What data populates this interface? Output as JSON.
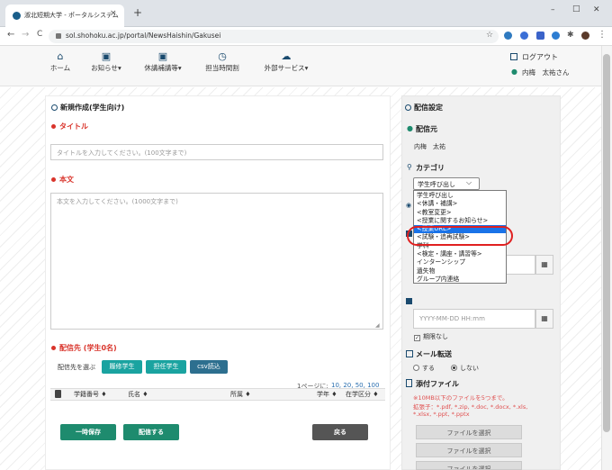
{
  "browser": {
    "tab_title": "淑北短期大学 - ポータルシステム",
    "tab_close": "×",
    "new_tab": "+",
    "url": "sol.shohoku.ac.jp/portal/NewsHaishin/Gakusei",
    "min": "–",
    "max": "□",
    "close": "✕"
  },
  "nav": {
    "items": [
      {
        "label": "ホーム",
        "icon": "home-icon",
        "glyph": "⌂"
      },
      {
        "label": "お知らせ▾",
        "icon": "news-icon",
        "glyph": "▣"
      },
      {
        "label": "休講補講等▾",
        "icon": "calendar-icon",
        "glyph": "▣"
      },
      {
        "label": "担当時間割",
        "icon": "clock-icon",
        "glyph": "◷"
      },
      {
        "label": "外部サービス▾",
        "icon": "cloud-icon",
        "glyph": "☁"
      }
    ],
    "logout": "ログアウト",
    "user": "内梅　太祐さん"
  },
  "left": {
    "heading": "新規作成(学生向け)",
    "title_label": "タイトル",
    "title_placeholder": "タイトルを入力してください。(100文字まで)",
    "body_label": "本文",
    "body_placeholder": "本文を入力してください。(1000文字まで)",
    "recipients_label": "配信先 (学生0名)",
    "select_prompt": "配信先を選ぶ",
    "btn_enrolled": "履修学生",
    "btn_charge": "担任学生",
    "btn_csv": "csv読込",
    "page_size_prefix": "1ページに: ",
    "page_sizes": "10, 20, 50, 100",
    "table_headers": {
      "student_no": "学籍番号 ♦",
      "name": "氏名 ♦",
      "affiliation": "所属 ♦",
      "year": "学年 ♦",
      "status": "在学区分 ♦"
    },
    "btn_draft": "一時保存",
    "btn_send": "配信する",
    "btn_back": "戻る"
  },
  "right": {
    "heading": "配信設定",
    "sender_label": "配信元",
    "sender_name": "内梅　太祐",
    "category_label": "カテゴリ",
    "category_selected": "学生呼び出し",
    "category_options": [
      "学生呼び出し",
      "<休講・補講>",
      "<教室変更>",
      "<授業に関するお知らせ>",
      "<授業URL>",
      "<試験・追再試験>",
      "学科",
      "<検定・講座・講習等>",
      "インターンシップ",
      "遺失物",
      "グループ内連絡"
    ],
    "datetime_placeholder": "YYYY-MM-DD HH:mm",
    "no_limit": "期限なし",
    "mail_label": "メール転送",
    "mail_yes": "する",
    "mail_no": "しない",
    "attach_label": "添付ファイル",
    "attach_note1": "※10MB以下のファイルを5つまで。",
    "attach_note2": "拡張子：*.pdf, *.zip, *.doc, *.docx, *.xls,",
    "attach_note3": "*.xlsx, *.ppt, *.pptx",
    "file_button": "ファイルを選択"
  },
  "colors": {
    "accent_red": "#d9342b",
    "teal": "#1aa3a0",
    "navy": "#2d6f8f",
    "green": "#1e8b6e",
    "highlight_ring": "#e02020",
    "selected_option": "#1a73e8"
  }
}
